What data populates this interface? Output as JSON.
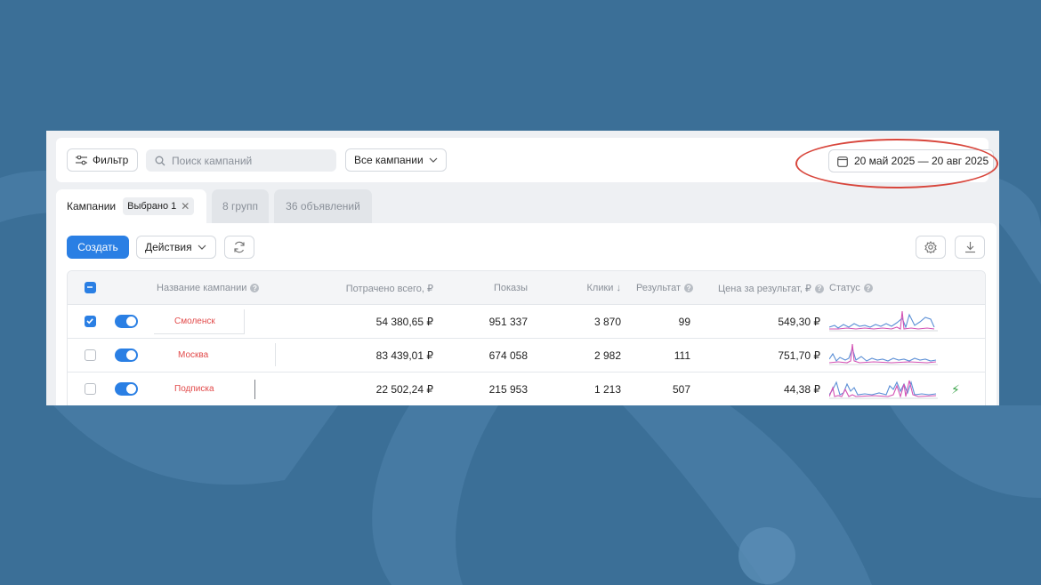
{
  "toolbar": {
    "filter_label": "Фильтр",
    "search_placeholder": "Поиск кампаний",
    "campaigns_select": "Все кампании",
    "date_range": "20 май 2025 — 20 авг 2025"
  },
  "tabs": [
    {
      "label": "Кампании",
      "badge": "Выбрано 1"
    },
    {
      "label": "8 групп"
    },
    {
      "label": "36 объявлений"
    }
  ],
  "actions": {
    "create_label": "Создать",
    "actions_label": "Действия"
  },
  "table": {
    "headers": {
      "name": "Название кампании",
      "spent": "Потрачено всего, ₽",
      "impressions": "Показы",
      "clicks": "Клики ↓",
      "result": "Результат",
      "cost": "Цена за результат, ₽",
      "status": "Статус"
    },
    "rows": [
      {
        "selected": true,
        "enabled": true,
        "name": "Смоленск",
        "spent": "54 380,65 ₽",
        "impressions": "951 337",
        "clicks": "3 870",
        "result": "99",
        "cost": "549,30 ₽"
      },
      {
        "selected": false,
        "enabled": true,
        "name": "Москва",
        "spent": "83 439,01 ₽",
        "impressions": "674 058",
        "clicks": "2 982",
        "result": "111",
        "cost": "751,70 ₽"
      },
      {
        "selected": false,
        "enabled": true,
        "name": "Подписка",
        "spent": "22 502,24 ₽",
        "impressions": "215 953",
        "clicks": "1 213",
        "result": "507",
        "cost": "44,38 ₽"
      }
    ]
  },
  "colors": {
    "background": "#3b6f97",
    "accent": "#2a7fe4",
    "highlight_oval": "#d8463c",
    "campaign_name": "#e24a4a",
    "spark_blue": "#5b8fd6",
    "spark_pink": "#d452b4",
    "bolt": "#3aa34a"
  },
  "icons": {
    "filter": "filter-sliders-icon",
    "search": "search-icon",
    "calendar": "calendar-icon",
    "refresh": "refresh-icon",
    "settings": "gear-icon",
    "download": "download-icon",
    "status_extra": "lightning-icon"
  }
}
